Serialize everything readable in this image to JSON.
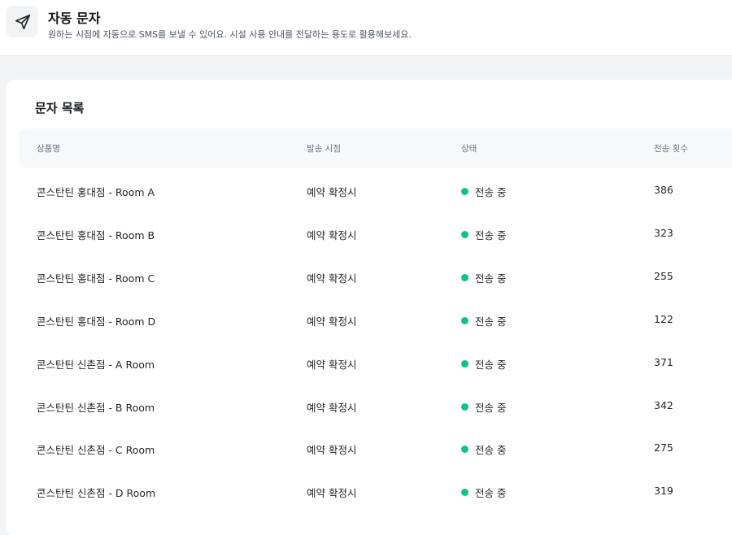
{
  "header": {
    "icon": "paper-plane-icon",
    "title": "자동 문자",
    "subtitle": "원하는 시점에 자동으로 SMS를 보낼 수 있어요. 시설 사용 안내를 전달하는 용도로 활용해보세요."
  },
  "list": {
    "title": "문자 목록",
    "columns": [
      "상품명",
      "발송 시점",
      "상태",
      "전송 횟수"
    ],
    "status_color": "#12c08d",
    "rows": [
      {
        "name": "콘스탄틴 홍대점 - Room A",
        "timing": "예약 확정시",
        "status": "전송 중",
        "count": "386"
      },
      {
        "name": "콘스탄틴 홍대점 - Room B",
        "timing": "예약 확정시",
        "status": "전송 중",
        "count": "323"
      },
      {
        "name": "콘스탄틴 홍대점 - Room C",
        "timing": "예약 확정시",
        "status": "전송 중",
        "count": "255"
      },
      {
        "name": "콘스탄틴 홍대점 - Room D",
        "timing": "예약 확정시",
        "status": "전송 중",
        "count": "122"
      },
      {
        "name": "콘스탄틴 신촌점 - A Room",
        "timing": "예약 확정시",
        "status": "전송 중",
        "count": "371"
      },
      {
        "name": "콘스탄틴 신촌점 - B Room",
        "timing": "예약 확정시",
        "status": "전송 중",
        "count": "342"
      },
      {
        "name": "콘스탄틴 신촌점 - C Room",
        "timing": "예약 확정시",
        "status": "전송 중",
        "count": "275"
      },
      {
        "name": "콘스탄틴 신촌점 - D Room",
        "timing": "예약 확정시",
        "status": "전송 중",
        "count": "319"
      }
    ]
  }
}
